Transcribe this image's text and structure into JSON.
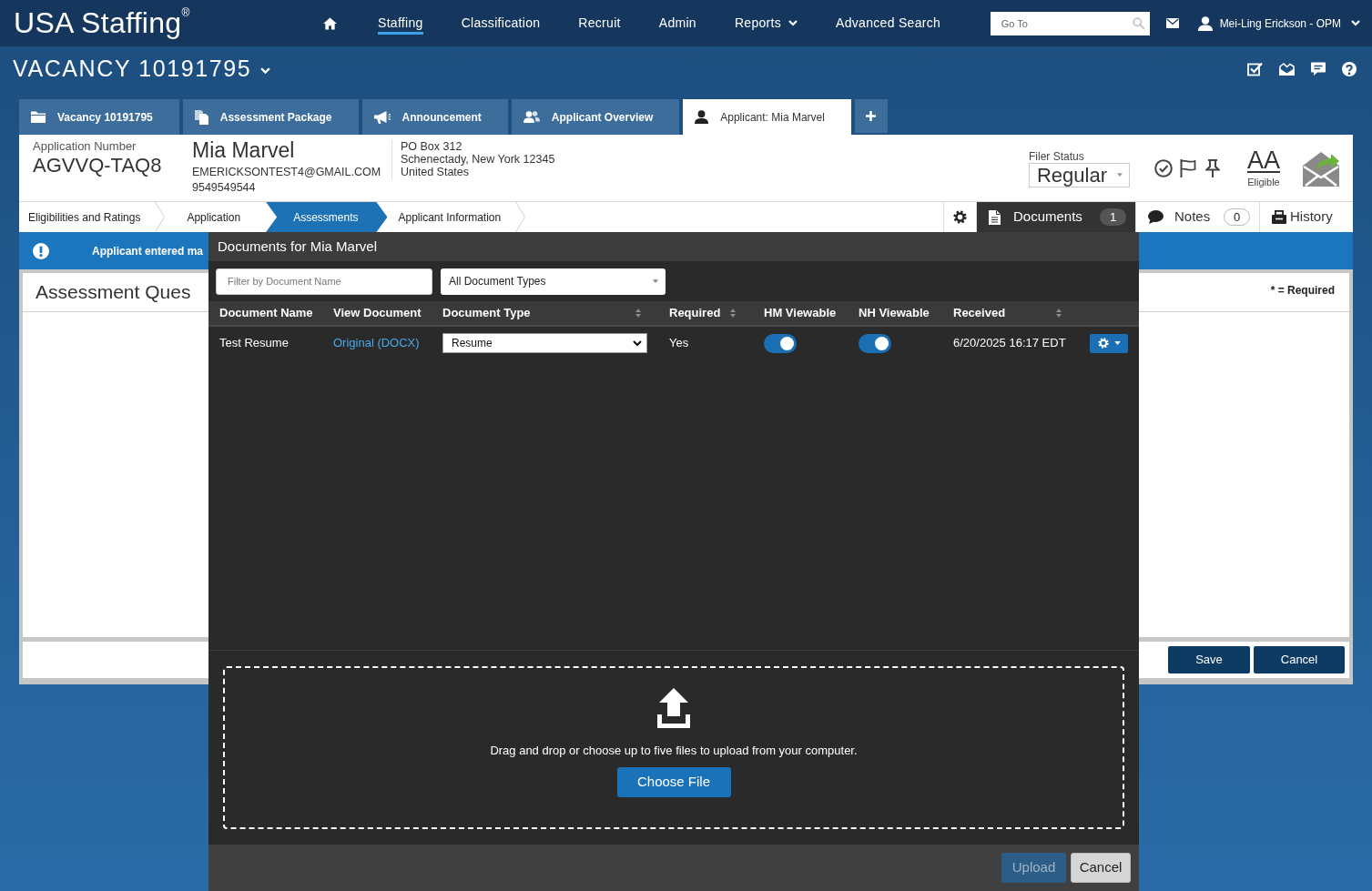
{
  "header": {
    "logo": "USA Staffing$^{®}$",
    "nav": [
      {
        "label": "Staffing",
        "selected": true,
        "kind": "link"
      },
      {
        "label": "Classification",
        "selected": false,
        "kind": "link"
      },
      {
        "label": "Recruit",
        "selected": false,
        "kind": "link"
      },
      {
        "label": "Admin",
        "selected": false,
        "kind": "link"
      },
      {
        "label": "Reports",
        "selected": false,
        "kind": "dropdown"
      },
      {
        "label": "Advanced Search",
        "selected": false,
        "kind": "link"
      }
    ],
    "search": {
      "placeholder": "Go To"
    },
    "user": {
      "name": "Mei-Ling Erickson - OPM"
    }
  },
  "vacancy": {
    "title": "VACANCY 10191795"
  },
  "tabs": [
    {
      "label": "Vacancy 10191795",
      "selected": false
    },
    {
      "label": "Assessment Package",
      "selected": false
    },
    {
      "label": "Announcement",
      "selected": false
    },
    {
      "label": "Applicant Overview",
      "selected": false
    },
    {
      "label": "Applicant: Mia Marvel",
      "selected": true
    }
  ],
  "applicant": {
    "number_label": "Application Number",
    "number": "AGVVQ-TAQ8",
    "name": "Mia Marvel",
    "email": "EMERICKSONTEST4@GMAIL.COM",
    "phone": "9549549544",
    "address": [
      "PO Box 312",
      "Schenectady, New York 12345",
      "United States"
    ],
    "filer_status": {
      "label": "Filer Status",
      "value": "Regular"
    },
    "eligibility": {
      "code": "AA",
      "label": "Eligible"
    }
  },
  "steps": [
    {
      "label": "Eligibilities and Ratings",
      "selected": false
    },
    {
      "label": "Application",
      "selected": false
    },
    {
      "label": "Assessments",
      "selected": true
    },
    {
      "label": "Applicant Information",
      "selected": false
    }
  ],
  "side_tabs": [
    {
      "label": "Documents",
      "count": "1",
      "selected": true
    },
    {
      "label": "Notes",
      "count": "0",
      "selected": false
    },
    {
      "label": "History",
      "selected": false
    }
  ],
  "alert": {
    "text": "Applicant entered ma"
  },
  "panel": {
    "title": "Assessment Ques",
    "required_note": "* = Required",
    "buttons": [
      "Save",
      "Cancel"
    ]
  },
  "modal": {
    "title": "Documents for Mia Marvel",
    "filter": {
      "placeholder": "Filter by Document Name"
    },
    "type_filter": {
      "value": "All Document Types"
    },
    "table": {
      "columns": [
        {
          "label": "Document Name",
          "sortable": false
        },
        {
          "label": "View Document",
          "sortable": false
        },
        {
          "label": "Document Type",
          "sortable": true
        },
        {
          "label": "Required",
          "sortable": true
        },
        {
          "label": "HM Viewable",
          "sortable": false
        },
        {
          "label": "NH Viewable",
          "sortable": false
        },
        {
          "label": "Received",
          "sortable": true
        }
      ],
      "rows": [
        {
          "document_name": "Test Resume",
          "view_document": "Original (DOCX)",
          "document_type": "Resume",
          "required": "Yes",
          "hm_viewable": true,
          "nh_viewable": true,
          "received": "6/20/2025 16:17 EDT"
        }
      ]
    },
    "dropzone": {
      "text": "Drag and drop or choose up to five files to upload from your computer.",
      "button": "Choose File"
    },
    "buttons": [
      {
        "label": "Upload",
        "kind": "primary",
        "disabled": true
      },
      {
        "label": "Cancel",
        "kind": "secondary",
        "disabled": false
      }
    ]
  }
}
